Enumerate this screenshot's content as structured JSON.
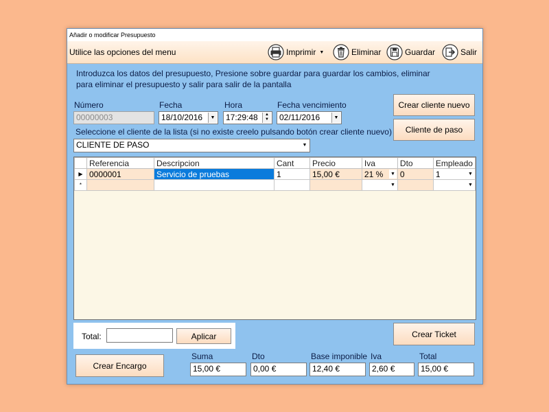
{
  "window": {
    "title": "Añadir o modificar Presupuesto"
  },
  "menu": {
    "title": "Utilice las opciones del menu",
    "print": "Imprimir",
    "delete": "Eliminar",
    "save": "Guardar",
    "exit": "Salir"
  },
  "instructions": "Introduzca los datos del presupuesto, Presione sobre guardar para guardar los cambios, eliminar para eliminar el presupuesto y salir para salir de la pantalla",
  "form": {
    "numero_label": "Número",
    "numero_value": "00000003",
    "fecha_label": "Fecha",
    "fecha_value": "18/10/2016",
    "hora_label": "Hora",
    "hora_value": "17:29:48",
    "venc_label": "Fecha vencimiento",
    "venc_value": "02/11/2016",
    "cliente_prompt": "Seleccione el cliente de la lista (si no existe creelo pulsando botón crear cliente nuevo)",
    "cliente_value": "CLIENTE DE PASO"
  },
  "buttons": {
    "crear_cliente": "Crear cliente nuevo",
    "cliente_paso": "Cliente de paso",
    "aplicar": "Aplicar",
    "crear_ticket": "Crear Ticket",
    "crear_encargo": "Crear Encargo"
  },
  "grid": {
    "columns": [
      "Referencia",
      "Descripcion",
      "Cant",
      "Precio",
      "Iva",
      "Dto",
      "Empleado"
    ],
    "rows": [
      {
        "referencia": "0000001",
        "descripcion": "Servicio de pruebas",
        "cant": "1",
        "precio": "15,00 €",
        "iva": "21 %",
        "dto": "0",
        "empleado": "1"
      }
    ],
    "new_row_marker": "*",
    "current_row_marker": "▶"
  },
  "total": {
    "label": "Total:",
    "value": ""
  },
  "summary": {
    "suma_label": "Suma",
    "suma_value": "15,00 €",
    "dto_label": "Dto",
    "dto_value": "0,00 €",
    "base_label": "Base imponible",
    "base_value": "12,40 €",
    "iva_label": "Iva",
    "iva_value": "2,60 €",
    "total_label": "Total",
    "total_value": "15,00 €"
  },
  "icons": {
    "print": "printer-icon",
    "delete": "trash-icon",
    "save": "floppy-icon",
    "exit": "exit-icon",
    "dropdown": "chevron-down-icon"
  },
  "colors": {
    "desktop": "#fbb88d",
    "form_bg": "#8fc2ee",
    "selection": "#0a7bdc",
    "peach_cell": "#fde6cf"
  }
}
